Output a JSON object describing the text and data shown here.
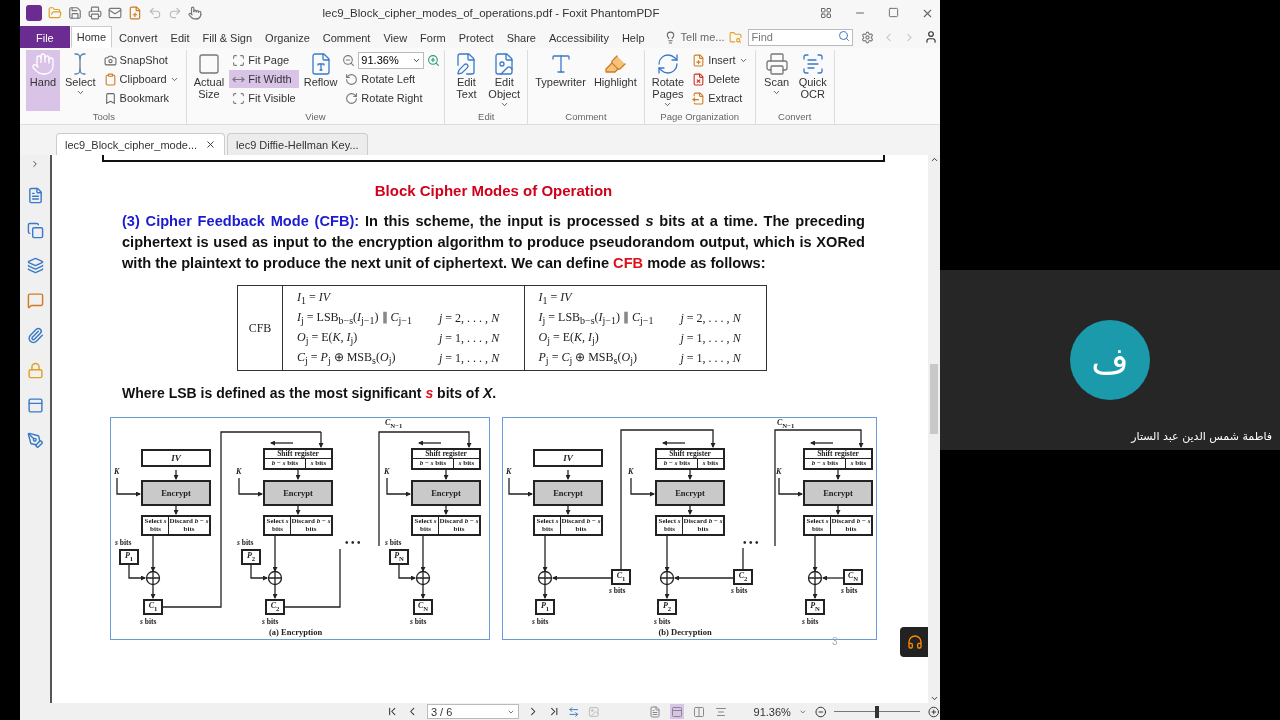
{
  "window": {
    "title": "lec9_Block_cipher_modes_of_operations.pdf - Foxit PhantomPDF"
  },
  "menu_tabs": [
    {
      "kind": "file",
      "label": "File",
      "selected": false
    },
    {
      "kind": "tab",
      "label": "Home",
      "selected": true
    },
    {
      "kind": "tab",
      "label": "Convert",
      "selected": false
    },
    {
      "kind": "tab",
      "label": "Edit",
      "selected": false
    },
    {
      "kind": "tab",
      "label": "Fill & Sign",
      "selected": false
    },
    {
      "kind": "tab",
      "label": "Organize",
      "selected": false
    },
    {
      "kind": "tab",
      "label": "Comment",
      "selected": false
    },
    {
      "kind": "tab",
      "label": "View",
      "selected": false
    },
    {
      "kind": "tab",
      "label": "Form",
      "selected": false
    },
    {
      "kind": "tab",
      "label": "Protect",
      "selected": false
    },
    {
      "kind": "tab",
      "label": "Share",
      "selected": false
    },
    {
      "kind": "tab",
      "label": "Accessibility",
      "selected": false
    },
    {
      "kind": "tab",
      "label": "Help",
      "selected": false
    }
  ],
  "tell_me": "Tell me...",
  "find": {
    "placeholder": "Find"
  },
  "ribbon": [
    {
      "label": "Tools",
      "items": [
        {
          "kind": "large",
          "label": "Hand",
          "selected": true,
          "dropdown": false
        },
        {
          "kind": "large",
          "label": "Select",
          "selected": false,
          "dropdown": true
        },
        {
          "kind": "stack",
          "items": [
            {
              "label": "SnapShot",
              "selected": false,
              "dropdown": false
            },
            {
              "label": "Clipboard",
              "selected": false,
              "dropdown": true
            },
            {
              "label": "Bookmark",
              "selected": false,
              "dropdown": false
            }
          ]
        }
      ]
    },
    {
      "label": "View",
      "items": [
        {
          "kind": "large",
          "label": "Actual Size",
          "selected": false,
          "dropdown": false
        },
        {
          "kind": "stack",
          "items": [
            {
              "label": "Fit Page",
              "selected": false,
              "dropdown": false
            },
            {
              "label": "Fit Width",
              "selected": true,
              "dropdown": false
            },
            {
              "label": "Fit Visible",
              "selected": false,
              "dropdown": false
            }
          ]
        },
        {
          "kind": "large",
          "label": "Reflow",
          "selected": false,
          "dropdown": false
        },
        {
          "kind": "zoomstack",
          "value": "91.36%",
          "items": [
            {
              "label": "Rotate Left",
              "selected": false,
              "dropdown": false
            },
            {
              "label": "Rotate Right",
              "selected": false,
              "dropdown": false
            }
          ]
        }
      ]
    },
    {
      "label": "Edit",
      "items": [
        {
          "kind": "large",
          "label": "Edit Text",
          "selected": false,
          "dropdown": false
        },
        {
          "kind": "large",
          "label": "Edit Object",
          "selected": false,
          "dropdown": true
        }
      ]
    },
    {
      "label": "Comment",
      "items": [
        {
          "kind": "large",
          "label": "Typewriter",
          "selected": false,
          "dropdown": false
        },
        {
          "kind": "large",
          "label": "Highlight",
          "selected": false,
          "dropdown": false
        }
      ]
    },
    {
      "label": "Page Organization",
      "items": [
        {
          "kind": "large",
          "label": "Rotate Pages",
          "selected": false,
          "dropdown": true
        },
        {
          "kind": "stack",
          "items": [
            {
              "label": "Insert",
              "selected": false,
              "dropdown": true
            },
            {
              "label": "Delete",
              "selected": false,
              "dropdown": false
            },
            {
              "label": "Extract",
              "selected": false,
              "dropdown": false
            }
          ]
        }
      ]
    },
    {
      "label": "Convert",
      "items": [
        {
          "kind": "large",
          "label": "Scan",
          "selected": false,
          "dropdown": true
        },
        {
          "kind": "large",
          "label": "Quick OCR",
          "selected": false,
          "dropdown": false
        }
      ]
    }
  ],
  "doc_tabs": [
    {
      "label": "lec9_Block_cipher_mode...",
      "selected": true
    },
    {
      "label": "lec9 Diffie-Hellman Key...",
      "selected": false
    }
  ],
  "document": {
    "title": "Block Cipher Modes of Operation",
    "intro": [
      {
        "kind": "label",
        "text": "(3) Cipher Feedback Mode (CFB):"
      },
      {
        "kind": "plain",
        "text": " In this scheme, the input is processed *s* bits at a time. The preceding ciphertext is used as input to the encryption algorithm to produce pseudorandom output, which is XORed with the plaintext to produce the next unit of ciphertext. We can define "
      },
      {
        "kind": "term",
        "text": "CFB"
      },
      {
        "kind": "plain",
        "text": " mode as follows:"
      }
    ],
    "table": {
      "mode": "CFB",
      "columns": [
        [
          {
            "eq": "*I*$_{1}$ = *IV*"
          },
          {
            "eq": "*I*$_{j}$ = LSB$_{b−s}$(*I*$_{j−1}$) ∥ *C*$_{j−1}$",
            "range": "*j* = 2, . . . , *N*"
          },
          {
            "eq": "*O*$_{j}$ = E(*K*, *I*$_{j}$)",
            "range": "*j* = 1, . . . , *N*"
          },
          {
            "eq": "*C*$_{j}$ = *P*$_{j}$ ⊕ MSB$_{s}$(*O*$_{j}$)",
            "range": "*j* = 1, . . . , *N*"
          }
        ],
        [
          {
            "eq": "*I*$_{1}$ = *IV*"
          },
          {
            "eq": "*I*$_{j}$ = LSB$_{b−s}$(*I*$_{j−1}$) ∥ *C*$_{j−1}$",
            "range": "*j* = 2, . . . , *N*"
          },
          {
            "eq": "*O*$_{j}$ = E(*K*, *I*$_{j}$)",
            "range": "*j* = 1, . . . , *N*"
          },
          {
            "eq": "*P*$_{j}$ = *C*$_{j}$ ⊕ MSB$_{s}$(*O*$_{j}$)",
            "range": "*j* = 1, . . . , *N*"
          }
        ]
      ]
    },
    "note": [
      {
        "kind": "plain",
        "text": "Where LSB is defined as the most significant "
      },
      {
        "kind": "term",
        "text": "*s*"
      },
      {
        "kind": "plain",
        "text": " bits of *X*."
      }
    ],
    "figures": [
      {
        "kind": "encryption",
        "caption": "(a) Encryption",
        "feedback_label": "*C*$_{N−1}$",
        "dots": "• • •",
        "stages": [
          {
            "top": {
              "kind": "iv",
              "text": "IV"
            },
            "key": "K",
            "block": "Encrypt",
            "select": "Select *s* bits",
            "discard": "Discard *b* − *s* bits",
            "in": "*P*$_{1}$",
            "in_bits": "*s* bits",
            "out": "*C*$_{1}$",
            "out_bits": "*s* bits"
          },
          {
            "top": {
              "kind": "shift",
              "title": "Shift register",
              "left": "*b* − *s* bits",
              "right": "*s* bits"
            },
            "key": "K",
            "block": "Encrypt",
            "select": "Select *s* bits",
            "discard": "Discard *b* − *s* bits",
            "in": "*P*$_{2}$",
            "in_bits": "*s* bits",
            "out": "*C*$_{2}$",
            "out_bits": "*s* bits"
          },
          {
            "top": {
              "kind": "shift",
              "title": "Shift register",
              "left": "*b* − *s* bits",
              "right": "*s* bits"
            },
            "key": "K",
            "block": "Encrypt",
            "select": "Select *s* bits",
            "discard": "Discard *b* − *s* bits",
            "in": "*P*$_{N}$",
            "in_bits": "*s* bits",
            "out": "*C*$_{N}$",
            "out_bits": "*s* bits"
          }
        ]
      },
      {
        "kind": "decryption",
        "caption": "(b) Decryption",
        "feedback_label": "*C*$_{N−1}$",
        "dots": "• • •",
        "stages": [
          {
            "top": {
              "kind": "iv",
              "text": "IV"
            },
            "key": "K",
            "block": "Encrypt",
            "select": "Select *s* bits",
            "discard": "Discard *b* − *s* bits",
            "in": "*C*$_{1}$",
            "in_bits": "*s* bits",
            "out": "*P*$_{1}$",
            "out_bits": "*s* bits"
          },
          {
            "top": {
              "kind": "shift",
              "title": "Shift register",
              "left": "*b* − *s* bits",
              "right": "*s* bits"
            },
            "key": "K",
            "block": "Encrypt",
            "select": "Select *s* bits",
            "discard": "Discard *b* − *s* bits",
            "in": "*C*$_{2}$",
            "in_bits": "*s* bits",
            "out": "*P*$_{2}$",
            "out_bits": "*s* bits"
          },
          {
            "top": {
              "kind": "shift",
              "title": "Shift register",
              "left": "*b* − *s* bits",
              "right": "*s* bits"
            },
            "key": "K",
            "block": "Encrypt",
            "select": "Select *s* bits",
            "discard": "Discard *b* − *s* bits",
            "in": "*C*$_{N}$",
            "in_bits": "*s* bits",
            "out": "*P*$_{N}$",
            "out_bits": "*s* bits"
          }
        ]
      }
    ],
    "page_number": "3"
  },
  "status_bar": {
    "page_field": "3 / 6",
    "view_modes": [
      {
        "selected": false
      },
      {
        "selected": true
      },
      {
        "selected": false
      },
      {
        "selected": false
      }
    ],
    "zoom": "91.36%",
    "zoom_slider": {
      "level": 0.47
    }
  },
  "participant": {
    "initial": "ف",
    "name": "فاطمة شمس الدين عبد الستار"
  }
}
